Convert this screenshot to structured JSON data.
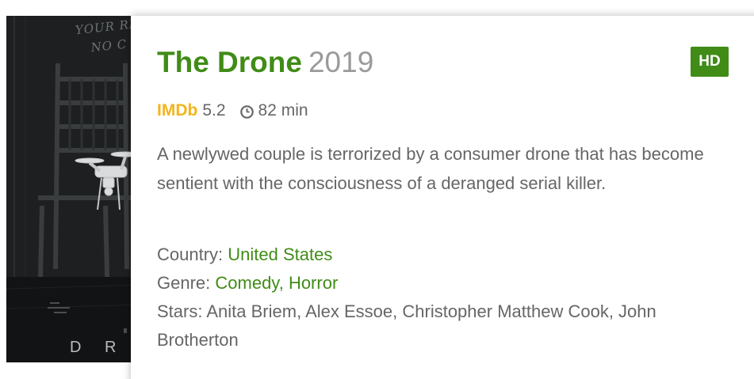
{
  "poster": {
    "tagline": "YOUR RE\n   NO C",
    "title_fragment": "D R"
  },
  "movie": {
    "title": "The Drone",
    "year": "2019",
    "quality": "HD",
    "imdb_label": "IMDb",
    "imdb_rating": "5.2",
    "duration": "82 min",
    "description": "A newlywed couple is terrorized by a consumer drone that has become sentient with the consciousness of a deranged serial killer.",
    "country_label": "Country:",
    "country": "United States",
    "genre_label": "Genre:",
    "genres": [
      "Comedy",
      "Horror"
    ],
    "genre_separator": ",",
    "stars_label": "Stars:",
    "stars": "Anita Briem, Alex Essoe, Christopher Matthew Cook, John Brotherton"
  },
  "colors": {
    "accent": "#408c17",
    "imdb": "#f3b51c",
    "text": "#666666",
    "year": "#9a9a9a"
  },
  "icons": {
    "duration": "clock-icon"
  }
}
